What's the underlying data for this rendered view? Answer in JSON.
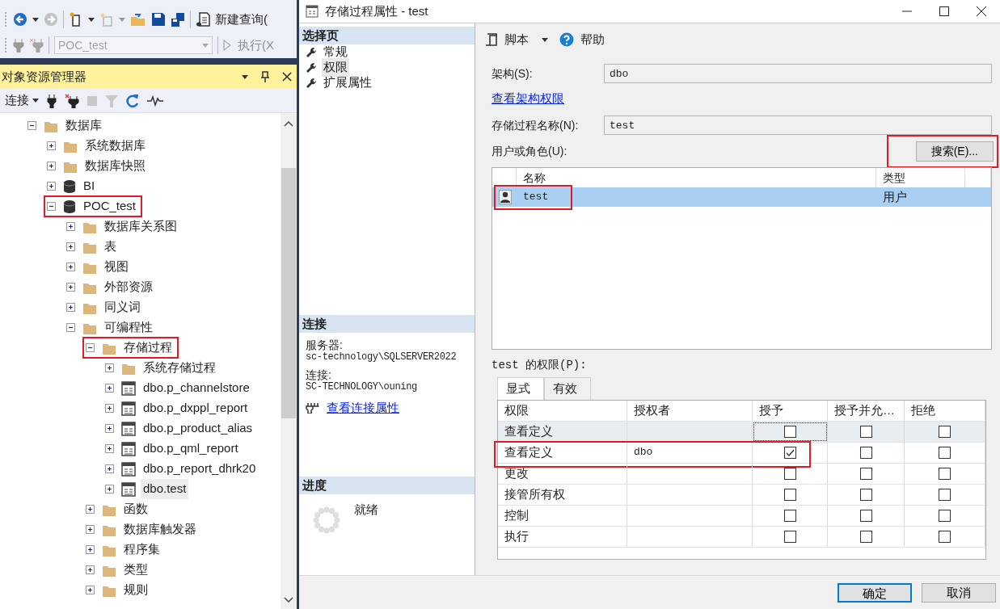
{
  "ssms_toolbar": {
    "new_query": "新建查询(",
    "database": "POC_test",
    "execute": "执行(X"
  },
  "object_explorer": {
    "title": "对象资源管理器",
    "connect": "连接",
    "tree": [
      {
        "label": "数据库",
        "kind": "folder",
        "expanded": true,
        "selected": false,
        "highlight": false,
        "children": [
          {
            "label": "系统数据库",
            "kind": "folder",
            "expanded": false,
            "selected": false,
            "highlight": false
          },
          {
            "label": "数据库快照",
            "kind": "folder",
            "expanded": false,
            "selected": false,
            "highlight": false
          },
          {
            "label": "BI",
            "kind": "database",
            "expanded": false,
            "selected": false,
            "highlight": false
          },
          {
            "label": "POC_test",
            "kind": "database",
            "expanded": true,
            "selected": false,
            "highlight": true,
            "children": [
              {
                "label": "数据库关系图",
                "kind": "folder",
                "expanded": false,
                "selected": false,
                "highlight": false
              },
              {
                "label": "表",
                "kind": "folder",
                "expanded": false,
                "selected": false,
                "highlight": false
              },
              {
                "label": "视图",
                "kind": "folder",
                "expanded": false,
                "selected": false,
                "highlight": false
              },
              {
                "label": "外部资源",
                "kind": "folder",
                "expanded": false,
                "selected": false,
                "highlight": false
              },
              {
                "label": "同义词",
                "kind": "folder",
                "expanded": false,
                "selected": false,
                "highlight": false
              },
              {
                "label": "可编程性",
                "kind": "folder",
                "expanded": true,
                "selected": false,
                "highlight": false,
                "children": [
                  {
                    "label": "存储过程",
                    "kind": "folder",
                    "expanded": true,
                    "selected": false,
                    "highlight": true,
                    "children": [
                      {
                        "label": "系统存储过程",
                        "kind": "folder",
                        "expanded": false,
                        "selected": false,
                        "highlight": false
                      },
                      {
                        "label": "dbo.p_channelstore",
                        "kind": "procedure",
                        "expanded": false,
                        "selected": false,
                        "highlight": false
                      },
                      {
                        "label": "dbo.p_dxppl_report",
                        "kind": "procedure",
                        "expanded": false,
                        "selected": false,
                        "highlight": false
                      },
                      {
                        "label": "dbo.p_product_alias",
                        "kind": "procedure",
                        "expanded": false,
                        "selected": false,
                        "highlight": false
                      },
                      {
                        "label": "dbo.p_qml_report",
                        "kind": "procedure",
                        "expanded": false,
                        "selected": false,
                        "highlight": false
                      },
                      {
                        "label": "dbo.p_report_dhrk20",
                        "kind": "procedure",
                        "expanded": false,
                        "selected": false,
                        "highlight": false
                      },
                      {
                        "label": "dbo.test",
                        "kind": "procedure",
                        "expanded": false,
                        "selected": true,
                        "highlight": false
                      }
                    ]
                  },
                  {
                    "label": "函数",
                    "kind": "folder",
                    "expanded": false,
                    "selected": false,
                    "highlight": false
                  },
                  {
                    "label": "数据库触发器",
                    "kind": "folder",
                    "expanded": false,
                    "selected": false,
                    "highlight": false
                  },
                  {
                    "label": "程序集",
                    "kind": "folder",
                    "expanded": false,
                    "selected": false,
                    "highlight": false
                  },
                  {
                    "label": "类型",
                    "kind": "folder",
                    "expanded": false,
                    "selected": false,
                    "highlight": false
                  },
                  {
                    "label": "规则",
                    "kind": "folder",
                    "expanded": false,
                    "selected": false,
                    "highlight": false
                  }
                ]
              }
            ]
          }
        ]
      }
    ]
  },
  "dialog": {
    "title": "存储过程属性 - test",
    "pages_header": "选择页",
    "pages": [
      {
        "label": "常规",
        "selected": false
      },
      {
        "label": "权限",
        "selected": true
      },
      {
        "label": "扩展属性",
        "selected": false
      }
    ],
    "connection_header": "连接",
    "server_label": "服务器:",
    "server": "sc-technology\\SQLSERVER2022",
    "connection_label": "连接:",
    "connection": "SC-TECHNOLOGY\\ouning",
    "connection_link": "查看连接属性",
    "progress_header": "进度",
    "progress_status": "就绪",
    "toolbar": {
      "script": "脚本",
      "help": "帮助"
    },
    "schema_label": "架构(S):",
    "schema": "dbo",
    "schema_link": "查看架构权限",
    "name_label": "存储过程名称(N):",
    "name": "test",
    "users_label": "用户或角色(U):",
    "search_button": {
      "label": "搜索(E)...",
      "highlight": true
    },
    "users": {
      "columns": [
        "名称",
        "类型"
      ],
      "rows": [
        {
          "name": "test",
          "type": "用户",
          "selected": true,
          "highlight": true
        }
      ]
    },
    "permissions_label": "test 的权限(P):",
    "permission_tabs": [
      {
        "label": "显式",
        "selected": true
      },
      {
        "label": "有效",
        "selected": false
      }
    ],
    "permissions": {
      "columns": [
        "权限",
        "授权者",
        "授予",
        "授予并允…",
        "拒绝"
      ],
      "rows": [
        {
          "permission": "查看定义",
          "grant": false,
          "with_grant": false,
          "deny": false,
          "selected": true,
          "highlight": false
        },
        {
          "permission": "查看定义",
          "grantor": "dbo",
          "grant": true,
          "with_grant": false,
          "deny": false,
          "selected": false,
          "highlight": true
        },
        {
          "permission": "更改",
          "grant": false,
          "with_grant": false,
          "deny": false,
          "selected": false,
          "highlight": false
        },
        {
          "permission": "接管所有权",
          "grant": false,
          "with_grant": false,
          "deny": false,
          "selected": false,
          "highlight": false
        },
        {
          "permission": "控制",
          "grant": false,
          "with_grant": false,
          "deny": false,
          "selected": false,
          "highlight": false
        },
        {
          "permission": "执行",
          "grant": false,
          "with_grant": false,
          "deny": false,
          "selected": false,
          "highlight": false
        }
      ]
    },
    "buttons": [
      {
        "label": "确定",
        "kind": "default"
      },
      {
        "label": "取消",
        "kind": "normal"
      }
    ]
  }
}
